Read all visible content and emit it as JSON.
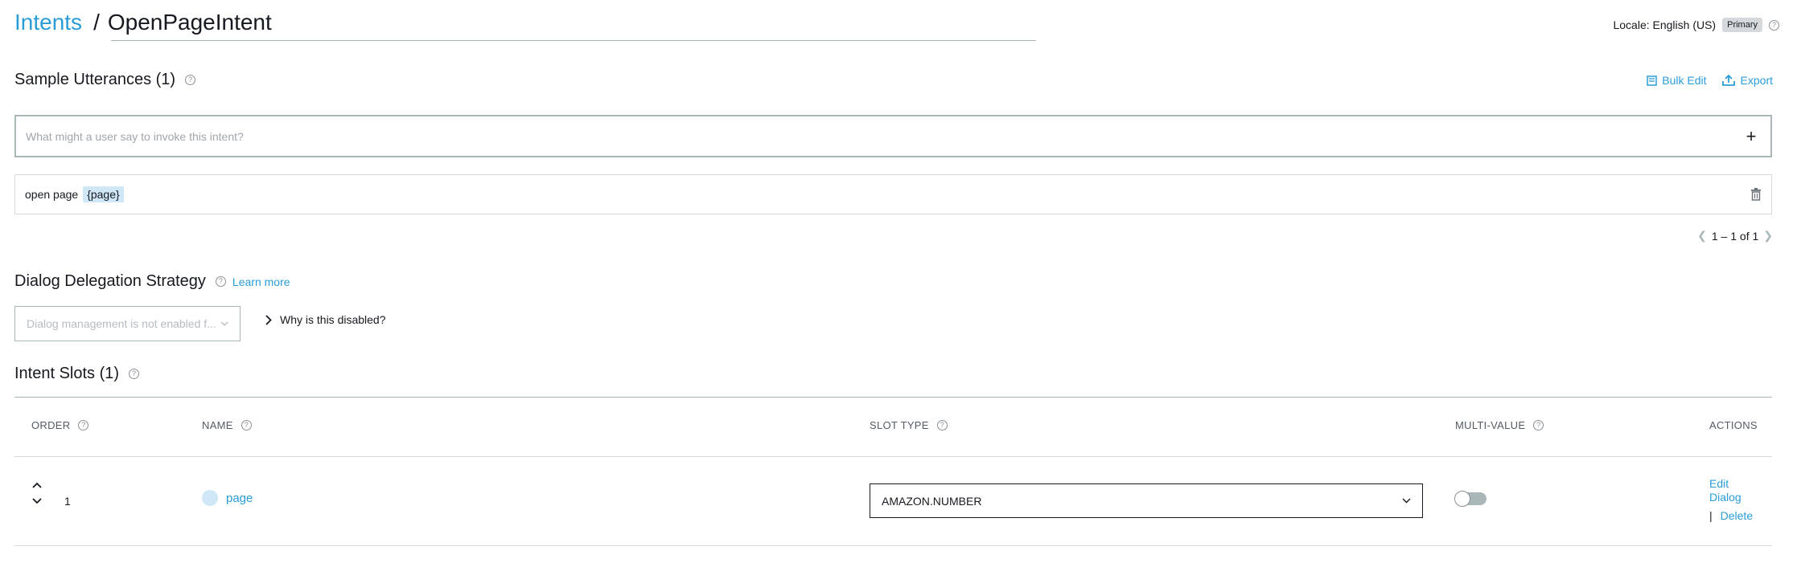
{
  "header": {
    "breadcrumb_root": "Intents",
    "breadcrumb_sep": "/",
    "intent_name": "OpenPageIntent",
    "locale_label": "Locale: English (US)",
    "locale_badge": "Primary"
  },
  "utterances": {
    "title": "Sample Utterances (1)",
    "bulk_edit": "Bulk Edit",
    "export": "Export",
    "input_placeholder": "What might a user say to invoke this intent?",
    "add_symbol": "+",
    "items": [
      {
        "text": "open page",
        "slot": "{page}"
      }
    ],
    "pager": "1 – 1 of 1"
  },
  "dialog": {
    "title": "Dialog Delegation Strategy",
    "learn_more": "Learn more",
    "select_placeholder": "Dialog management is not enabled f...",
    "why_disabled": "Why is this disabled?"
  },
  "slots": {
    "title": "Intent Slots (1)",
    "columns": {
      "order": "ORDER",
      "name": "NAME",
      "slot_type": "SLOT TYPE",
      "multi_value": "MULTI-VALUE",
      "actions": "ACTIONS"
    },
    "rows": [
      {
        "order": "1",
        "name": "page",
        "slot_type": "AMAZON.NUMBER",
        "multi_value": false,
        "edit_dialog": "Edit Dialog",
        "delete": "Delete"
      }
    ]
  },
  "colors": {
    "link": "#2a9dd6",
    "slot_highlight": "#cfe7f7",
    "border": "#aab7b8"
  }
}
